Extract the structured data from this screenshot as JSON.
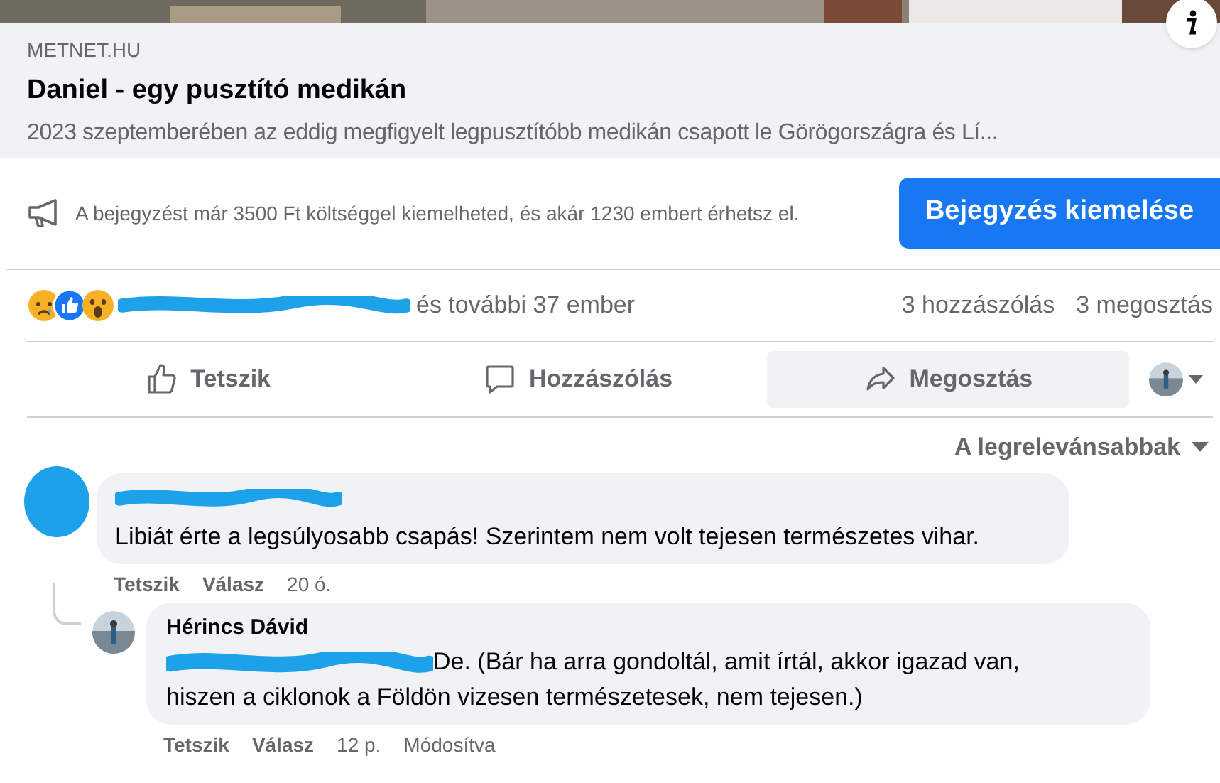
{
  "link_preview": {
    "domain": "METNET.HU",
    "title": "Daniel - egy pusztító medikán",
    "description": "2023 szeptemberében az eddig megfigyelt legpusztítóbb medikán csapott le Görögországra és Lí..."
  },
  "promotion": {
    "text": "A bejegyzést már 3500 Ft költséggel kiemelheted, és akár 1230 embert érhetsz el.",
    "button": "Bejegyzés kiemelése"
  },
  "reactions": {
    "others": "és további 37 ember",
    "comments": "3 hozzászólás",
    "shares": "3 megosztás"
  },
  "actions": [
    {
      "kind": "like",
      "label": "Tetszik",
      "highlighted": false
    },
    {
      "kind": "comment",
      "label": "Hozzászólás",
      "highlighted": false
    },
    {
      "kind": "share",
      "label": "Megosztás",
      "highlighted": true
    }
  ],
  "sort": {
    "label": "A legrelevánsabbak"
  },
  "comments": [
    {
      "author_redacted": true,
      "text": "Libiát érte a legsúlyosabb csapás! Szerintem nem volt tejesen természetes vihar.",
      "like": "Tetszik",
      "reply": "Válasz",
      "time": "20 ó.",
      "replies": [
        {
          "author": "Hérincs Dávid",
          "mention_redacted": true,
          "text": "De. (Bár ha arra gondoltál, amit írtál, akkor igazad van, hiszen a ciklonok a Földön vizesen természetesek, nem tejesen.)",
          "like": "Tetszik",
          "reply": "Válasz",
          "time": "12 p.",
          "edited": "Módosítva"
        }
      ]
    }
  ]
}
